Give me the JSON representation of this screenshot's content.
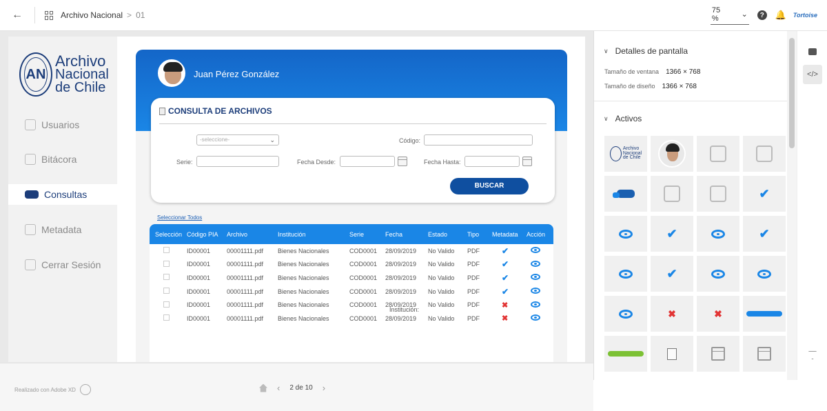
{
  "topbar": {
    "back_icon": "arrow-left-icon",
    "project_title": "Archivo Nacional",
    "separator": ">",
    "page": "01",
    "zoom": "75 %",
    "help_icon": "question-icon",
    "notification_icon": "bell-icon",
    "brand": "Tortoise"
  },
  "sidebar": {
    "logo": {
      "line1": "Archivo",
      "line2": "Nacional",
      "line3": "de Chile"
    },
    "items": [
      {
        "label": "Usuarios",
        "icon": "user-icon"
      },
      {
        "label": "Bitácora",
        "icon": "clipboard-icon"
      },
      {
        "label": "Consultas",
        "icon": "chat-icon"
      },
      {
        "label": "Metadata",
        "icon": "cube-icon"
      },
      {
        "label": "Cerrar Sesión",
        "icon": "logout-icon"
      }
    ]
  },
  "header": {
    "user_name": "Juan Pérez González"
  },
  "form": {
    "title": "CONSULTA DE ARCHIVOS",
    "select_placeholder": "-seleccione-",
    "codigo_label": "Código:",
    "serie_label": "Serie:",
    "fecha_desde_label": "Fecha Desde:",
    "fecha_hasta_label": "Fecha Hasta:",
    "search_button": "BUSCAR"
  },
  "select_all": "Seleccionar Todos",
  "table": {
    "columns": [
      "Selección",
      "Código PIA",
      "Archivo",
      "Institución",
      "Serie",
      "Fecha",
      "Estado",
      "Tipo",
      "Metadata",
      "Acción"
    ],
    "rows": [
      {
        "codigo": "ID00001",
        "archivo": "00001111.pdf",
        "institucion": "Bienes Nacionales",
        "serie": "COD0001",
        "fecha": "28/09/2019",
        "estado": "No Valido",
        "tipo": "PDF",
        "metadata": "✔",
        "overlay": ""
      },
      {
        "codigo": "ID00001",
        "archivo": "00001111.pdf",
        "institucion": "Bienes Nacionales",
        "serie": "COD0001",
        "fecha": "28/09/2019",
        "estado": "No Valido",
        "tipo": "PDF",
        "metadata": "✔",
        "overlay": ""
      },
      {
        "codigo": "ID00001",
        "archivo": "00001111.pdf",
        "institucion": "Bienes Nacionales",
        "serie": "COD0001",
        "fecha": "28/09/2019",
        "estado": "No Valido",
        "tipo": "PDF",
        "metadata": "✔",
        "overlay": ""
      },
      {
        "codigo": "ID00001",
        "archivo": "00001111.pdf",
        "institucion": "Bienes Nacionales",
        "serie": "COD0001",
        "fecha": "28/09/2019",
        "estado": "No Valido",
        "tipo": "PDF",
        "metadata": "✔",
        "overlay": ""
      },
      {
        "codigo": "ID00001",
        "archivo": "00001111.pdf",
        "institucion": "Bienes Nacionales",
        "serie": "COD0001",
        "fecha": "28/09/2019",
        "estado": "No Valido",
        "tipo": "PDF",
        "metadata": "✖",
        "overlay": "Institución:"
      },
      {
        "codigo": "ID00001",
        "archivo": "00001111.pdf",
        "institucion": "Bienes Nacionales",
        "serie": "COD0001",
        "fecha": "28/09/2019",
        "estado": "No Valido",
        "tipo": "PDF",
        "metadata": "✖",
        "overlay": ""
      }
    ]
  },
  "footer": {
    "made_with": "Realizado con Adobe XD",
    "pagination": "2 de 10"
  },
  "right_panel": {
    "screen_details_title": "Detalles de pantalla",
    "window_size_label": "Tamaño de ventana",
    "window_size_value": "1366 × 768",
    "design_size_label": "Tamaño de diseño",
    "design_size_value": "1366 × 768",
    "assets_title": "Activos",
    "assets": [
      "logo",
      "avatar",
      "user-icon",
      "clipboard-icon",
      "chat-icon",
      "logout-icon",
      "cube-icon",
      "check-icon",
      "eye-icon",
      "check-icon",
      "eye-icon",
      "check-icon",
      "eye-icon",
      "check-icon",
      "eye-icon",
      "eye-icon",
      "eye-icon",
      "x-icon",
      "x-icon",
      "blue-button",
      "green-button",
      "document-icon",
      "calendar-icon",
      "calendar-icon"
    ]
  },
  "colors": {
    "primary": "#1a86e6",
    "dark_blue": "#0f4fa0",
    "navy": "#1c3d7a",
    "error": "#e23434"
  }
}
